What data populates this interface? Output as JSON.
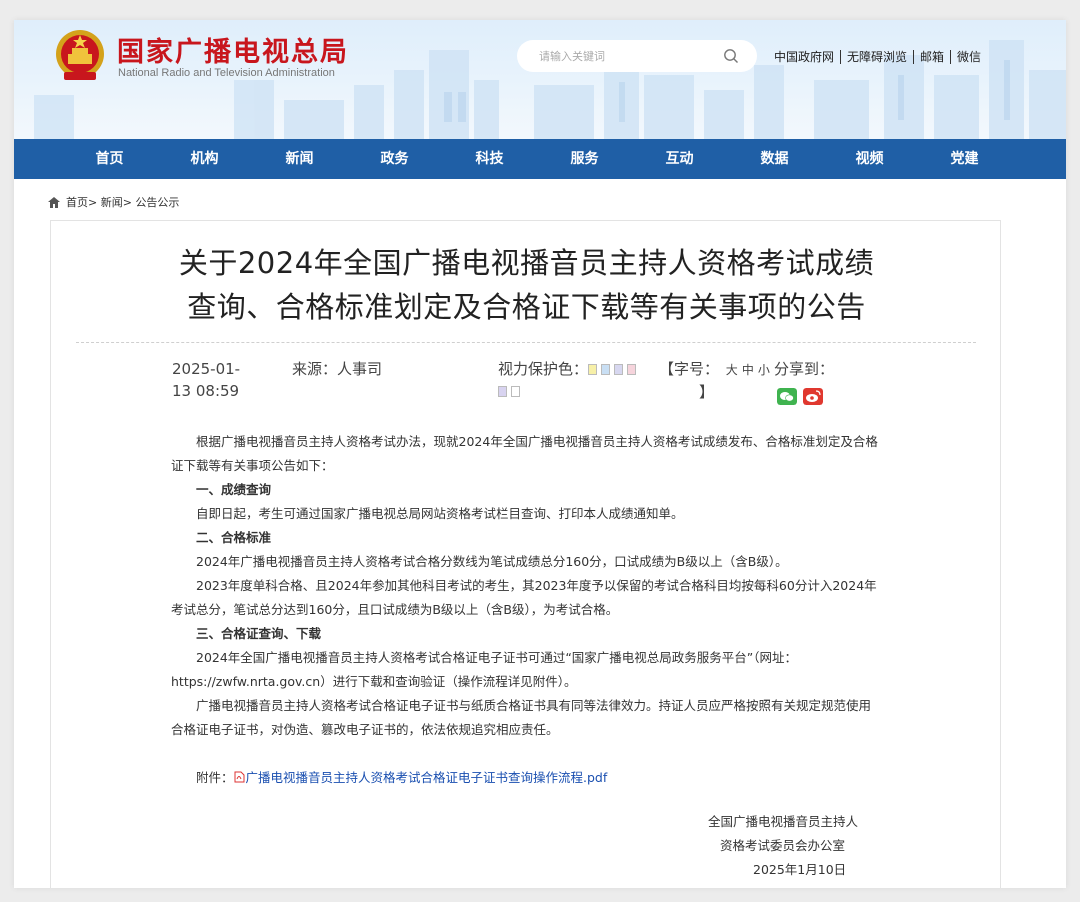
{
  "header": {
    "site_name_cn": "国家广播电视总局",
    "site_name_en": "National Radio and Television Administration",
    "search_placeholder": "请输入关键词",
    "top_links": [
      "中国政府网",
      "无障碍浏览",
      "邮箱",
      "微信"
    ]
  },
  "nav": [
    "首页",
    "机构",
    "新闻",
    "政务",
    "科技",
    "服务",
    "互动",
    "数据",
    "视频",
    "党建"
  ],
  "breadcrumb": [
    "首页>",
    "新闻>",
    "公告公示"
  ],
  "article": {
    "title_line1": "关于2024年全国广播电视播音员主持人资格考试成绩",
    "title_line2": "查询、合格标准划定及合格证下载等有关事项的公告",
    "date_line1": "2025-01-",
    "date_line2": "13 08:59",
    "source": "来源：人事司",
    "vision_label": "视力保护色：",
    "vision_colors": [
      "#f7f0a8",
      "#c9dff4",
      "#d7d7f0",
      "#f6d4dc",
      "#d8d3f0",
      "#ffffff"
    ],
    "font_label": "【字号：",
    "font_sizes": [
      "大",
      "中",
      "小"
    ],
    "font_close": "】",
    "share_label": "分享到：",
    "paragraphs": [
      {
        "type": "p",
        "text": "根据广播电视播音员主持人资格考试办法，现就2024年全国广播电视播音员主持人资格考试成绩发布、合格标准划定及合格证下载等有关事项公告如下："
      },
      {
        "type": "h",
        "text": "一、成绩查询"
      },
      {
        "type": "p",
        "text": "自即日起，考生可通过国家广播电视总局网站资格考试栏目查询、打印本人成绩通知单。"
      },
      {
        "type": "h",
        "text": "二、合格标准"
      },
      {
        "type": "p",
        "text": "2024年广播电视播音员主持人资格考试合格分数线为笔试成绩总分160分，口试成绩为B级以上（含B级）。"
      },
      {
        "type": "p",
        "text": "2023年度单科合格、且2024年参加其他科目考试的考生，其2023年度予以保留的考试合格科目均按每科60分计入2024年考试总分，笔试总分达到160分，且口试成绩为B级以上（含B级），为考试合格。"
      },
      {
        "type": "h",
        "text": "三、合格证查询、下载"
      },
      {
        "type": "p",
        "text": "2024年全国广播电视播音员主持人资格考试合格证电子证书可通过“国家广播电视总局政务服务平台”（网址：https://zwfw.nrta.gov.cn）进行下载和查询验证（操作流程详见附件）。"
      },
      {
        "type": "p",
        "text": "广播电视播音员主持人资格考试合格证电子证书与纸质合格证书具有同等法律效力。持证人员应严格按照有关规定规范使用合格证电子证书，对伪造、篡改电子证书的，依法依规追究相应责任。"
      }
    ],
    "attachment_label": "附件：",
    "attachment_link": "广播电视播音员主持人资格考试合格证电子证书查询操作流程.pdf",
    "signature": [
      "全国广播电视播音员主持人",
      "资格考试委员会办公室",
      "2025年1月10日"
    ]
  }
}
